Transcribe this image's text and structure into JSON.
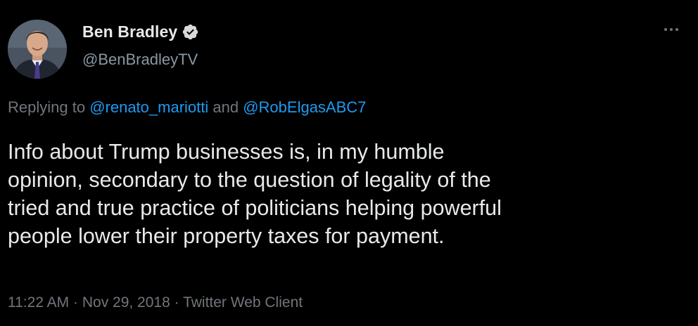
{
  "author": {
    "display_name": "Ben Bradley",
    "handle": "@BenBradleyTV",
    "verified": true,
    "avatar_icon": "profile-photo"
  },
  "reply": {
    "prefix": "Replying to ",
    "mention_1": "@renato_mariotti",
    "joiner": " and ",
    "mention_2": "@RobElgasABC7"
  },
  "tweet": {
    "text": "Info about Trump businesses is, in my humble\nopinion, secondary to the question of legality of the\ntried and true practice of politicians helping powerful\npeople lower their property taxes for payment."
  },
  "meta": {
    "time": "11:22 AM",
    "sep1": " · ",
    "date": "Nov 29, 2018",
    "sep2": " · ",
    "source": "Twitter Web Client"
  },
  "colors": {
    "background": "#000000",
    "text": "#e7e9ea",
    "secondary": "#71767b",
    "link": "#1d9bf0",
    "verified": "#d9d9d9"
  }
}
